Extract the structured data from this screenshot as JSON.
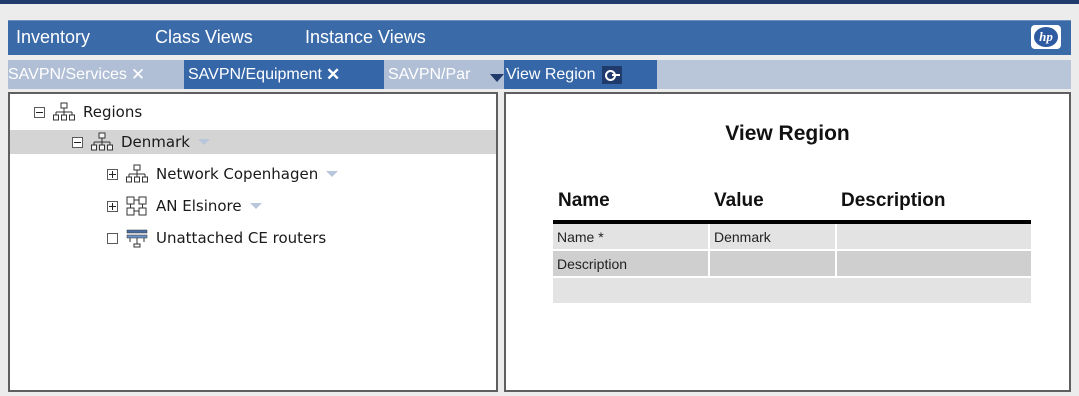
{
  "nav": {
    "items": [
      "Inventory",
      "Class Views",
      "Instance Views"
    ],
    "logo": "hp"
  },
  "tabs": [
    {
      "label": "SAVPN/Services",
      "close": "✕",
      "state": "inactive"
    },
    {
      "label": "SAVPN/Equipment",
      "close": "✕",
      "state": "active"
    },
    {
      "label": "SAVPN/Par",
      "state": "inactive",
      "menu": "chevron-down-icon"
    },
    {
      "label": "View Region",
      "state": "active",
      "icon": "key-icon"
    }
  ],
  "tree": {
    "root": {
      "label": "Regions",
      "toggle": "collapse",
      "icon": "network-building-icon"
    },
    "selected": {
      "label": "Denmark",
      "toggle": "collapse",
      "icon": "network-building-icon"
    },
    "children": [
      {
        "label": "Network Copenhagen",
        "toggle": "expand",
        "icon": "network-building-icon"
      },
      {
        "label": "AN Elsinore",
        "toggle": "expand",
        "icon": "access-network-icon"
      },
      {
        "label": "Unattached CE routers",
        "toggle": "leaf",
        "icon": "router-icon"
      }
    ]
  },
  "view_region": {
    "title": "View Region",
    "columns": [
      "Name",
      "Value",
      "Description"
    ],
    "rows": [
      {
        "name": "Name *",
        "value": "Denmark",
        "description": ""
      },
      {
        "name": "Description",
        "value": "",
        "description": ""
      },
      {
        "name": "",
        "value": "",
        "description": ""
      }
    ]
  },
  "colors": {
    "nav_bg": "#3a6aa8",
    "tab_active": "#3566a8",
    "tab_inactive": "#b0bfd6",
    "selected_row": "#d4d4d4"
  }
}
